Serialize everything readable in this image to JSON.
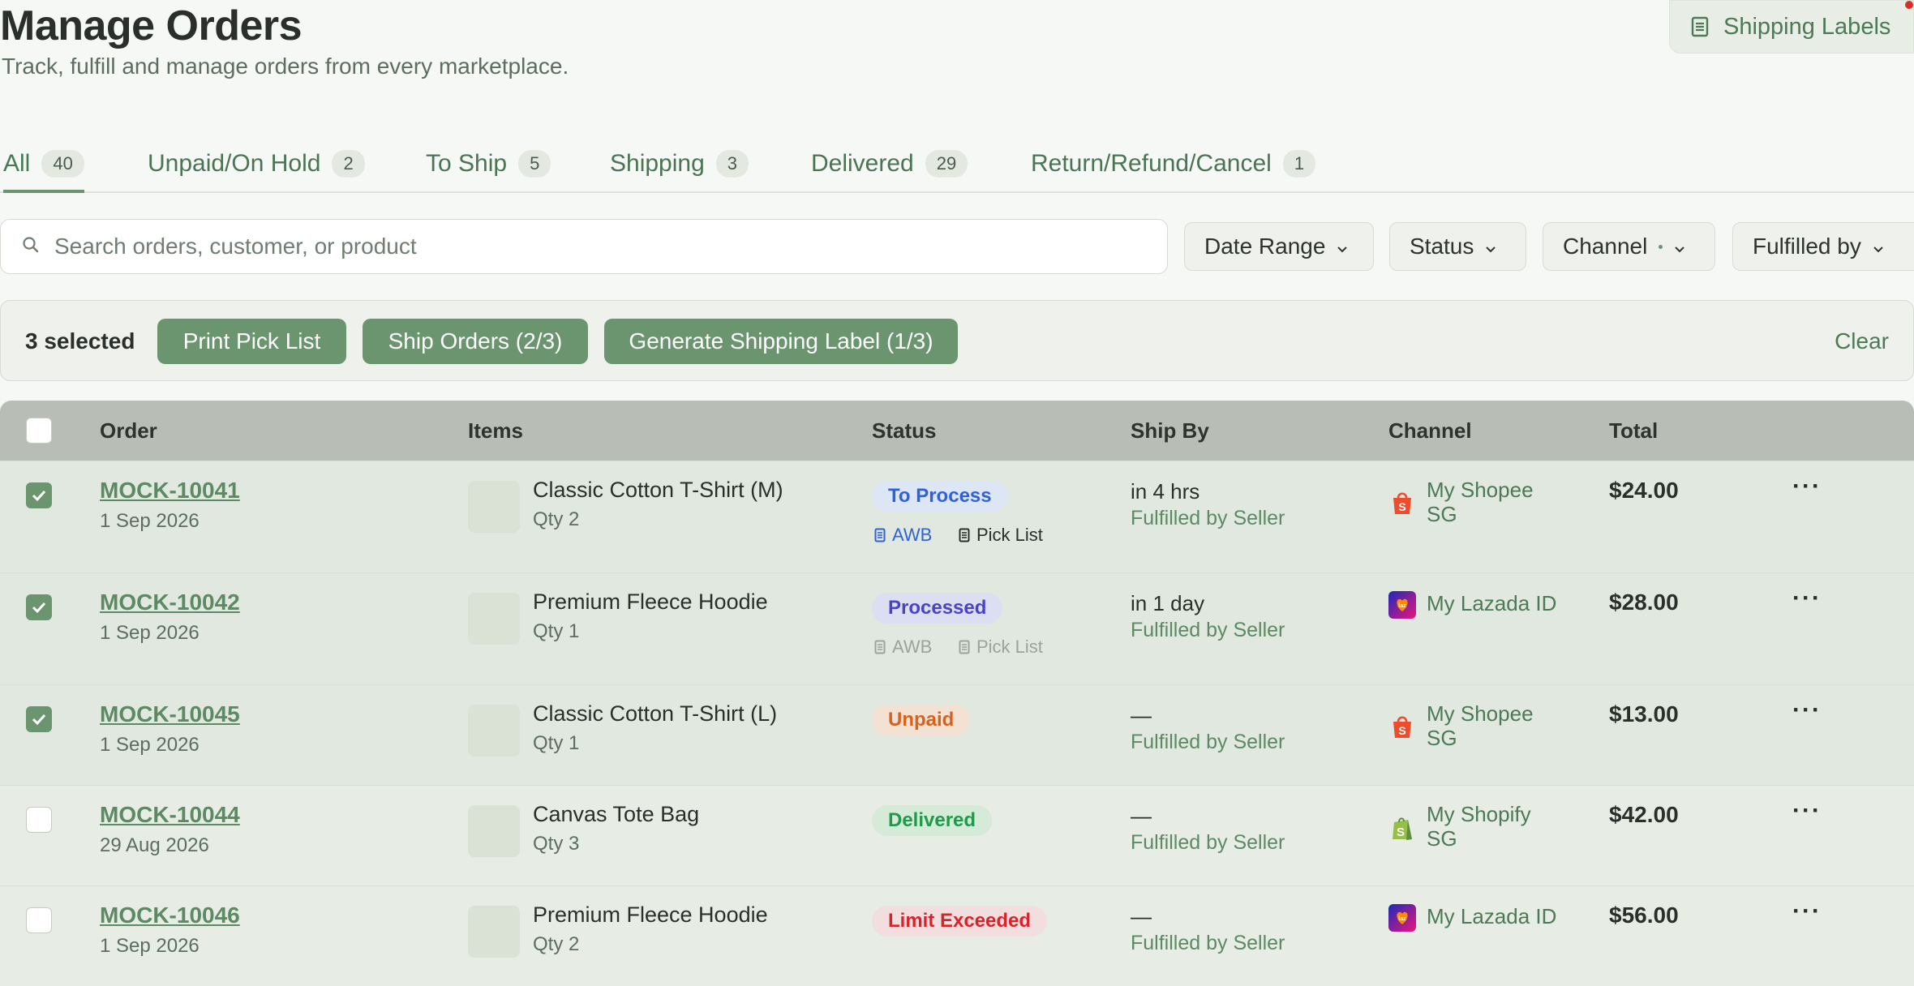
{
  "header": {
    "title": "Manage Orders",
    "subtitle": "Track, fulfill and manage orders from every marketplace.",
    "shipping_labels_button": "Shipping Labels"
  },
  "tabs": [
    {
      "label": "All",
      "count": "40",
      "active": true
    },
    {
      "label": "Unpaid/On Hold",
      "count": "2"
    },
    {
      "label": "To Ship",
      "count": "5"
    },
    {
      "label": "Shipping",
      "count": "3"
    },
    {
      "label": "Delivered",
      "count": "29"
    },
    {
      "label": "Return/Refund/Cancel",
      "count": "1"
    }
  ],
  "search": {
    "placeholder": "Search orders, customer, or product"
  },
  "filters": {
    "date_range": "Date Range",
    "status": "Status",
    "channel": "Channel",
    "fulfilled_by": "Fulfilled by"
  },
  "bulk": {
    "selected": "3 selected",
    "print_pick_list": "Print Pick List",
    "ship_orders": "Ship Orders (2/3)",
    "generate_label": "Generate Shipping Label (1/3)",
    "clear": "Clear"
  },
  "table": {
    "columns": {
      "order": "Order",
      "items": "Items",
      "status": "Status",
      "ship_by": "Ship By",
      "channel": "Channel",
      "total": "Total"
    },
    "rows": [
      {
        "checked": true,
        "order_id": "MOCK-10041",
        "date": "1 Sep 2026",
        "item": "Classic Cotton T-Shirt (M)",
        "qty": "Qty 2",
        "status": "To Process",
        "status_color": "#2f62d6",
        "status_bg": "#dde6f5",
        "awb": "AWB",
        "pick_list": "Pick List",
        "ship_time": "in 4 hrs",
        "fulfilled": "Fulfilled by Seller",
        "channel": "My Shopee SG",
        "channel_icon": "shopee-icon",
        "total": "$24.00"
      },
      {
        "checked": true,
        "order_id": "MOCK-10042",
        "date": "1 Sep 2026",
        "item": "Premium Fleece Hoodie",
        "qty": "Qty 1",
        "status": "Processed",
        "status_color": "#4a44c4",
        "status_bg": "#dcdff2",
        "awb": "AWB",
        "pick_list": "Pick List",
        "ship_time": "in 1 day",
        "fulfilled": "Fulfilled by Seller",
        "channel": "My Lazada ID",
        "channel_icon": "lazada-icon",
        "total": "$28.00"
      },
      {
        "checked": true,
        "order_id": "MOCK-10045",
        "date": "1 Sep 2026",
        "item": "Classic Cotton T-Shirt (L)",
        "qty": "Qty 1",
        "status": "Unpaid",
        "status_color": "#d8621c",
        "status_bg": "#f3e2d3",
        "ship_time": "—",
        "fulfilled": "Fulfilled by Seller",
        "channel": "My Shopee SG",
        "channel_icon": "shopee-icon",
        "total": "$13.00"
      },
      {
        "checked": false,
        "order_id": "MOCK-10044",
        "date": "29 Aug 2026",
        "item": "Canvas Tote Bag",
        "qty": "Qty 3",
        "status": "Delivered",
        "status_color": "#1f9a4a",
        "status_bg": "#d6ead8",
        "ship_time": "—",
        "fulfilled": "Fulfilled by Seller",
        "channel": "My Shopify SG",
        "channel_icon": "shopify-icon",
        "total": "$42.00"
      },
      {
        "checked": false,
        "order_id": "MOCK-10046",
        "date": "1 Sep 2026",
        "item": "Premium Fleece Hoodie",
        "qty": "Qty 2",
        "status": "Limit Exceeded",
        "status_color": "#d8232a",
        "status_bg": "#f2dede",
        "ship_time": "—",
        "fulfilled": "Fulfilled by Seller",
        "channel": "My Lazada ID",
        "channel_icon": "lazada-icon",
        "total": "$56.00"
      }
    ]
  },
  "colors": {
    "accent": "#6a956f",
    "link": "#5b8a63",
    "header_bg": "#b8beb5",
    "awb_active": "#2f62d6",
    "doc_disabled": "#9aa39c"
  }
}
